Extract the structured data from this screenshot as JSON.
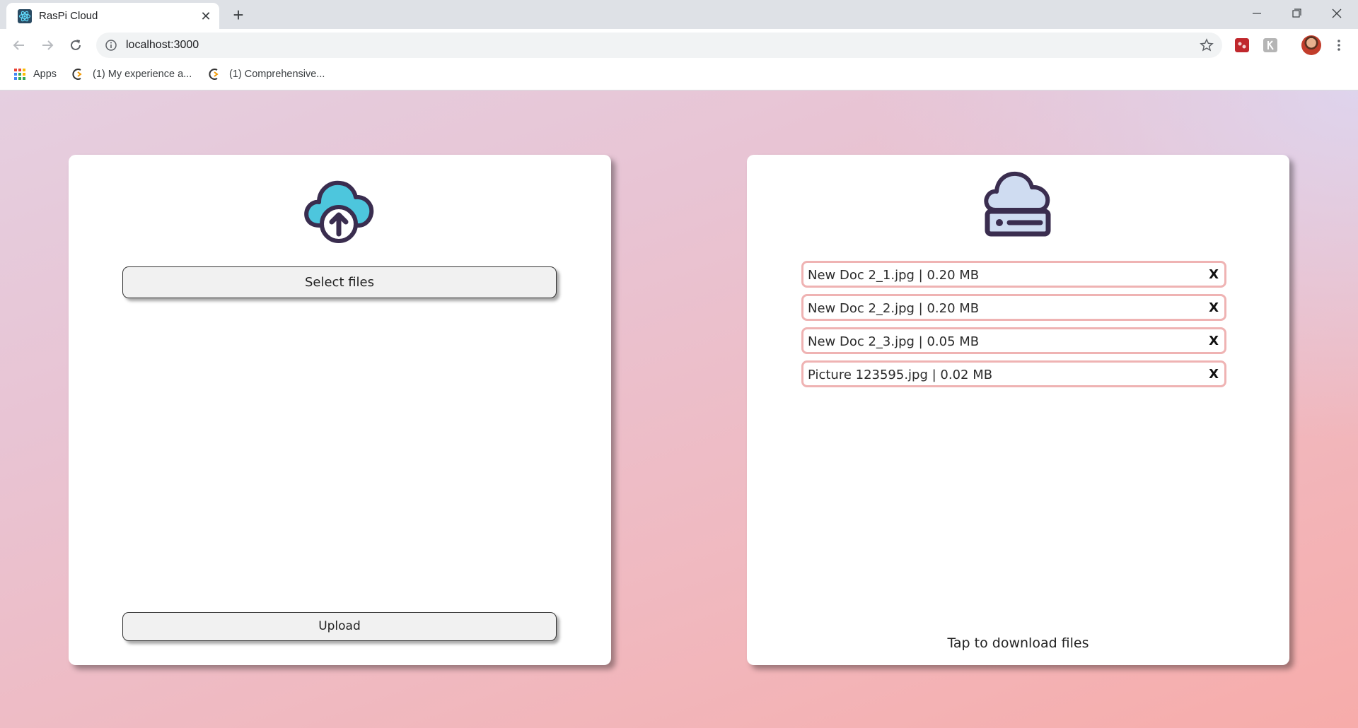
{
  "browser": {
    "tab_title": "RasPi Cloud",
    "tab_close": "✕",
    "new_tab": "+",
    "url": "localhost:3000",
    "bookmarks": [
      {
        "label": "Apps"
      },
      {
        "label": "(1) My experience a..."
      },
      {
        "label": "(1) Comprehensive..."
      }
    ]
  },
  "upload_panel": {
    "select_label": "Select files",
    "upload_label": "Upload"
  },
  "download_panel": {
    "files": [
      {
        "label": "New Doc 2_1.jpg | 0.20 MB",
        "remove": "X"
      },
      {
        "label": "New Doc 2_2.jpg | 0.20 MB",
        "remove": "X"
      },
      {
        "label": "New Doc 2_3.jpg | 0.05 MB",
        "remove": "X"
      },
      {
        "label": "Picture 123595.jpg | 0.02 MB",
        "remove": "X"
      }
    ],
    "hint": "Tap to download files"
  },
  "colors": {
    "cloud_upload_fill": "#4dc6dd",
    "cloud_server_fill": "#cfdcf1",
    "icon_outline": "#3a2d4f",
    "file_border": "#efb3b3"
  }
}
